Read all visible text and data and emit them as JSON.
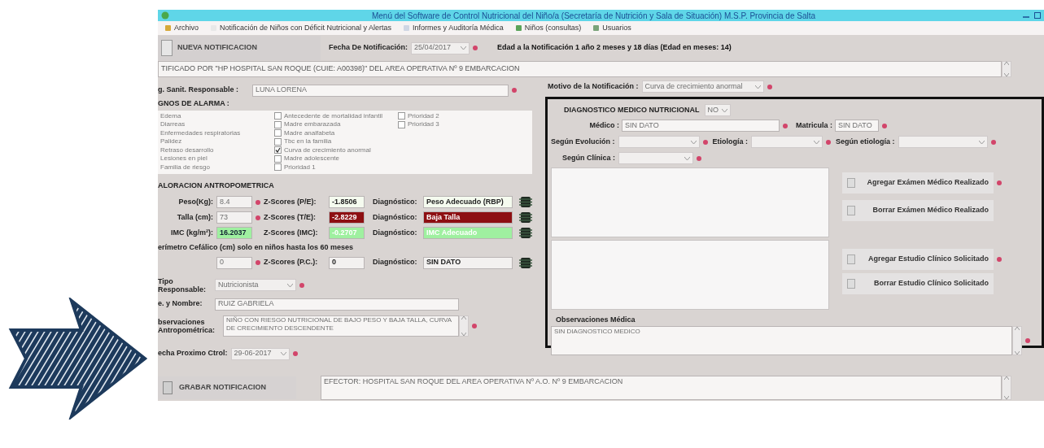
{
  "window": {
    "title": "Menú del Software de Control Nutricional del Niño/a (Secretaría de Nutrición y Sala de Situación) M.S.P. Provincia de Salta"
  },
  "menu": [
    {
      "label": "Archivo"
    },
    {
      "label": "Notificación de Niños con Déficit Nutricional y Alertas"
    },
    {
      "label": "Informes y Auditoría Médica"
    },
    {
      "label": "Niños (consultas)"
    },
    {
      "label": "Usuarios"
    }
  ],
  "toolbar": {
    "new_button": "NUEVA NOTIFICACION",
    "date_label": "Fecha De Notificación:",
    "date_value": "25/04/2017",
    "date_required": true,
    "age": "Edad a la Notificación 1 año 2 meses y 18 días (Edad en meses: 14)"
  },
  "notified_by": "TIFICADO POR \"HP HOSPITAL SAN ROQUE (CUIE: A00398)\" DEL AREA OPERATIVA Nº 9 EMBARCACION",
  "responsible": {
    "label": "g. Sanit. Responsable :",
    "value": "LUNA LORENA",
    "required": true
  },
  "reason": {
    "label": "Motivo de la Notificación :",
    "value": "Curva de crecimiento anormal",
    "required": true
  },
  "alarm_signs": {
    "title": "GNOS DE ALARMA :",
    "list": [
      "Edema",
      "Diarreas",
      "Enfermedades respiratorias",
      "Palidez",
      "Retraso desarrollo",
      "Lesiones en piel",
      "Familia de riesgo"
    ],
    "checks": [
      {
        "label": "Antecedente de mortalidad infantil",
        "checked": false
      },
      {
        "label": "Madre embarazada",
        "checked": false
      },
      {
        "label": "Madre analfabeta",
        "checked": false
      },
      {
        "label": "Tbc en la familia",
        "checked": false
      },
      {
        "label": "Curva de crecimiento anormal",
        "checked": true
      },
      {
        "label": "Madre adolescente",
        "checked": false
      },
      {
        "label": "Prioridad 1",
        "checked": false
      }
    ],
    "checks_2": [
      {
        "label": "Prioridad 2",
        "checked": false
      },
      {
        "label": "Prioridad 3",
        "checked": false
      }
    ]
  },
  "anthropometry": {
    "title": "ALORACION ANTROPOMETRICA",
    "note": "erímetro Cefálico (cm) solo en niños hasta los 60 meses",
    "rows": [
      {
        "kind": "measure",
        "label": "Peso(Kg):",
        "value": "8.4",
        "value_ok": false,
        "required": true,
        "z_label": "Z-Scores (P/E):",
        "z_value": "-1.8506",
        "diag_label": "Diagnóstico:",
        "diag": "Peso Adecuado (RBP)",
        "color": "#f5fbef"
      },
      {
        "kind": "measure",
        "label": "Talla (cm):",
        "value": "73",
        "value_ok": false,
        "required": true,
        "z_label": "Z-Scores (T/E):",
        "z_value": "-2.8229",
        "diag_label": "Diagnóstico:",
        "diag": "Baja Talla",
        "color": "#8d0f12"
      },
      {
        "kind": "measure",
        "label": "IMC (kg/m²):",
        "value": "16.2037",
        "value_ok": true,
        "required": false,
        "z_label": "Z-Scores (IMC):",
        "z_value": "-0.2707",
        "diag_label": "Diagnóstico:",
        "diag": "IMC Adecuado",
        "color": "#9ff0a0"
      },
      {
        "kind": "note"
      },
      {
        "kind": "measure",
        "value": "0",
        "value_ok": false,
        "required": true,
        "z_label": "Z-Scores (P.C.):",
        "z_value": "0",
        "diag_label": "Diagnóstico:",
        "diag": "SIN DATO",
        "color": "#f3f1f0"
      }
    ]
  },
  "responsible_type": {
    "label": "Tipo Responsable:",
    "value": "Nutricionista",
    "required": true
  },
  "name": {
    "label": "e. y Nombre:",
    "value": "RUIZ GABRIELA"
  },
  "observations": {
    "label": "bservaciones Antropométrica:",
    "value": "NIÑO CON RIESGO NUTRICIONAL DE BAJO PESO Y BAJA TALLA, CURVA DE CRECIMIENTO DESCENDENTE",
    "required": true
  },
  "next_control": {
    "label": "echa Proximo Ctrol:",
    "value": "29-06-2017",
    "required": true
  },
  "save_button": "GRABAR NOTIFICACION",
  "efector": "EFECTOR: HOSPITAL SAN ROQUE DEL AREA OPERATIVA Nº A.O. Nº 9 EMBARCACION",
  "diagnosis": {
    "title": "DIAGNOSTICO MEDICO NUTRICIONAL",
    "toggle": "NO",
    "doctor": {
      "label": "Médico :",
      "value": "SIN DATO",
      "required": true
    },
    "license": {
      "label": "Matricula :",
      "value": "SIN DATO",
      "required": true
    },
    "combos": [
      {
        "label": "Según Evolución :",
        "required": true
      },
      {
        "label": "Etiología :",
        "required": true
      },
      {
        "label": "Según etiología :",
        "required": true
      }
    ],
    "clinic": {
      "label": "Según Clínica :",
      "required": true
    },
    "exam_buttons": [
      {
        "label": "Agregar Exámen Médico Realizado",
        "required": true
      },
      {
        "label": "Borrar Exámen Médico Realizado",
        "required": false
      }
    ],
    "study_buttons": [
      {
        "label": "Agregar Estudio Clínico Solicitado",
        "required": true
      },
      {
        "label": "Borrar Estudio Clínico Solicitado",
        "required": false
      }
    ],
    "observations": {
      "label": "Observaciones Médica",
      "value": "SIN DIAGNOSTICO MEDICO",
      "required": true
    }
  }
}
